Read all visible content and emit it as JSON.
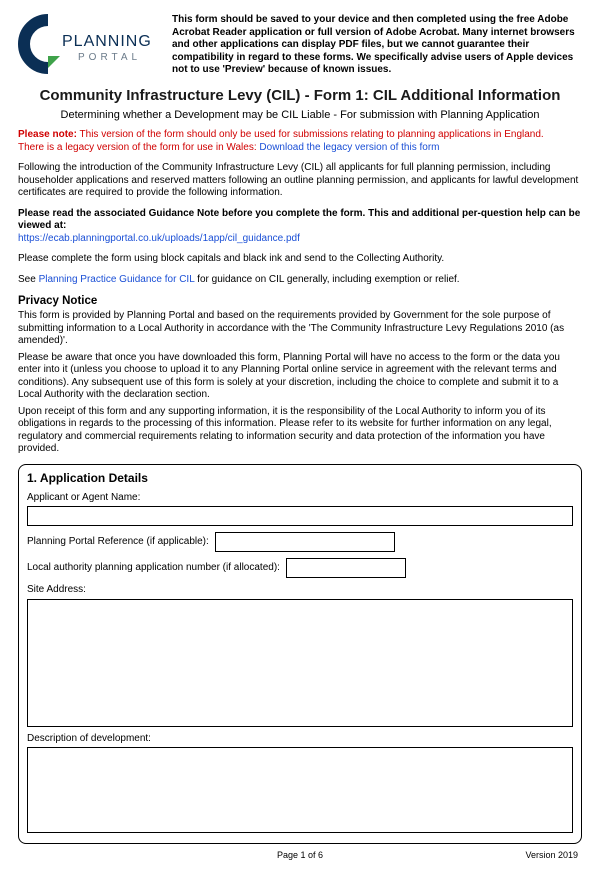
{
  "header": {
    "logo": {
      "name": "planning-portal-logo",
      "brand_upper": "PLANNING",
      "brand_lower": "P O R T A L"
    },
    "notice": "This form should be saved to your device and then completed using the free Adobe Acrobat Reader application or full version of Adobe Acrobat. Many internet browsers and other applications can display PDF files, but we cannot guarantee their compatibility in regard to these forms. We specifically advise users of Apple devices not to use 'Preview' because of known issues."
  },
  "title": "Community Infrastructure Levy (CIL) - Form 1: CIL Additional Information",
  "subtitle": "Determining whether a Development may be CIL Liable - For submission with Planning Application",
  "please_note": {
    "label": "Please note:",
    "line1": "This version of the form should only be used for submissions relating to planning applications in England.",
    "line2_prefix": "There is a legacy version of the form for use in Wales:  ",
    "link": "Download the legacy version of this form"
  },
  "intro": "Following the introduction of the Community Infrastructure Levy (CIL) all applicants for full planning permission, including householder applications and reserved matters following an outline planning permission, and applicants for lawful development certificates are required to provide the following information.",
  "guidance_line": "Please read the associated Guidance Note before you complete the form. This and additional per-question help can be viewed at:",
  "guidance_link": "https://ecab.planningportal.co.uk/uploads/1app/cil_guidance.pdf",
  "block_caps": "Please complete the form using block capitals and black ink and send to the Collecting Authority.",
  "see_line": {
    "prefix": "See ",
    "link": "Planning Practice Guidance for CIL",
    "suffix": " for guidance on CIL generally, including exemption or relief."
  },
  "privacy": {
    "heading": "Privacy Notice",
    "p1": "This form is provided by Planning Portal and based on the requirements provided by Government for the sole purpose of submitting information to a Local Authority in accordance with the 'The Community Infrastructure Levy Regulations 2010 (as amended)'.",
    "p2": "Please be aware that once you have downloaded this form, Planning Portal will have no access to the form or the data you enter into it (unless you choose to upload it to any Planning Portal online service in agreement with the relevant terms and conditions). Any subsequent use of this form is solely at your discretion, including the choice to complete and submit it to a Local Authority with the declaration section.",
    "p3": "Upon receipt of this form and any supporting information, it is the responsibility of the Local Authority to inform you of its obligations in regards to the processing of this information. Please refer to its website for further information on any legal, regulatory and commercial requirements relating to information security and data protection of the information you have provided."
  },
  "section1": {
    "title": "1. Application Details",
    "applicant_label": "Applicant or Agent Name:",
    "applicant_value": "",
    "pp_ref_label": "Planning Portal Reference (if applicable):",
    "pp_ref_value": "",
    "la_num_label": "Local authority planning application number (if allocated):",
    "la_num_value": "",
    "site_label": "Site Address:",
    "site_value": "",
    "desc_label": "Description of development:",
    "desc_value": ""
  },
  "footer": {
    "page": "Page 1 of 6",
    "version": "Version 2019"
  }
}
